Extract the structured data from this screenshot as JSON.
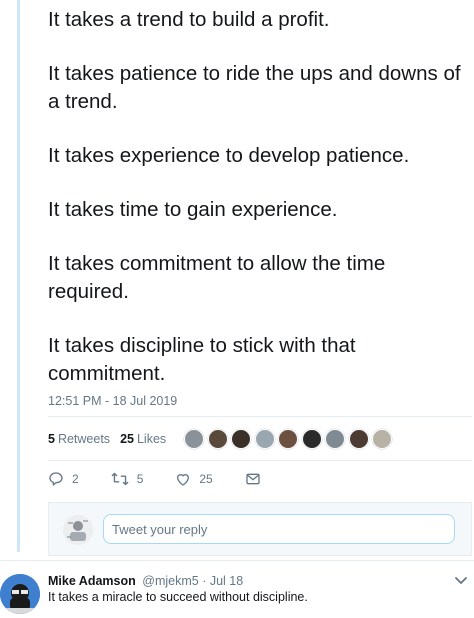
{
  "tweet": {
    "paragraphs": [
      "It takes a trend to build a profit.",
      "It takes patience to ride the ups and downs of a trend.",
      "It takes experience to develop patience.",
      "It takes time to gain experience.",
      "It takes commitment to allow the time required.",
      "It takes discipline to stick with that commitment."
    ],
    "timestamp": "12:51 PM - 18 Jul 2019",
    "stats": {
      "retweets_count": "5",
      "retweets_label": "Retweets",
      "likes_count": "25",
      "likes_label": "Likes"
    },
    "liker_avatar_colors": [
      "#8a9199",
      "#5a4a3c",
      "#3b2f2a",
      "#9aa6b0",
      "#6d5040",
      "#2a2a2a",
      "#7f8a93",
      "#4b3b32",
      "#b8b2a6"
    ],
    "actions": {
      "reply_count": "2",
      "retweet_count": "5",
      "like_count": "25"
    }
  },
  "reply_box": {
    "placeholder": "Tweet your reply"
  },
  "reply_tweet": {
    "name": "Mike Adamson",
    "handle": "@mjekm5",
    "date": "· Jul 18",
    "text": "It takes a miracle to succeed without discipline."
  },
  "colors": {
    "thread_line": "#cfe8f9",
    "secondary_text": "#657786",
    "primary_text": "#14171a",
    "input_border": "#a4d9f9"
  }
}
